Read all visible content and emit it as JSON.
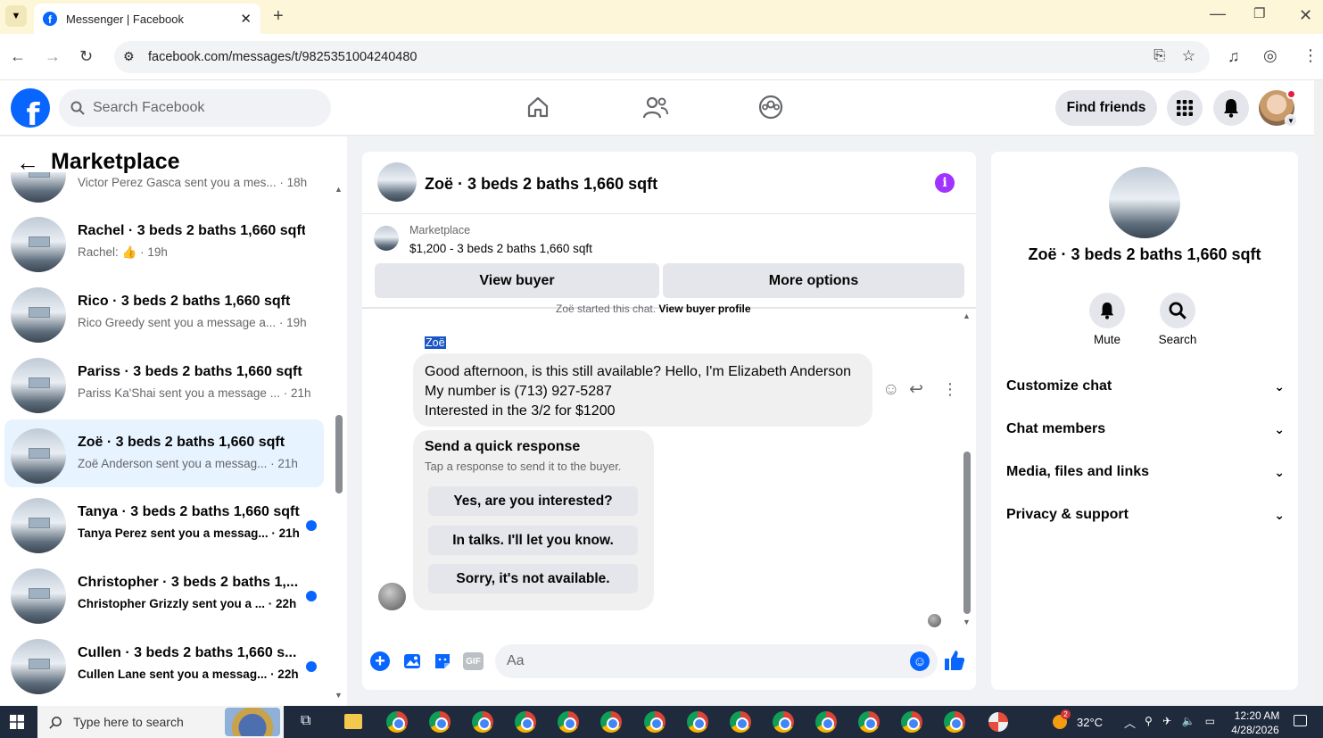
{
  "browser": {
    "tab_title": "Messenger | Facebook",
    "url": "facebook.com/messages/t/9825351004240480"
  },
  "fb_header": {
    "search_placeholder": "Search Facebook",
    "find_friends": "Find friends"
  },
  "marketplace": {
    "title": "Marketplace",
    "conversations": [
      {
        "title": "Victor · 3 beds 2 baths 1,660 sqft",
        "snippet": "Victor Perez Gasca sent you a mes... · 18h",
        "unread": false,
        "active": false
      },
      {
        "title": "Rachel · 3 beds 2 baths 1,660 sqft",
        "snippet": "Rachel: 👍 · 19h",
        "unread": false,
        "active": false
      },
      {
        "title": "Rico · 3 beds 2 baths 1,660 sqft",
        "snippet": "Rico Greedy sent you a message a... · 19h",
        "unread": false,
        "active": false
      },
      {
        "title": "Pariss · 3 beds 2 baths 1,660 sqft",
        "snippet": "Pariss Ka'Shai sent you a message ... · 21h",
        "unread": false,
        "active": false
      },
      {
        "title": "Zoë · 3 beds 2 baths 1,660 sqft",
        "snippet": "Zoë Anderson sent you a messag... · 21h",
        "unread": false,
        "active": true
      },
      {
        "title": "Tanya · 3 beds 2 baths 1,660 sqft",
        "snippet": "Tanya Perez sent you a messag... · 21h",
        "unread": true,
        "active": false
      },
      {
        "title": "Christopher · 3 beds 2 baths 1,...",
        "snippet": "Christopher Grizzly sent you a ... · 22h",
        "unread": true,
        "active": false
      },
      {
        "title": "Cullen · 3 beds 2 baths 1,660 s...",
        "snippet": "Cullen Lane sent you a messag... · 22h",
        "unread": true,
        "active": false
      }
    ]
  },
  "chat": {
    "title": "Zoë · 3 beds 2 baths 1,660 sqft",
    "listing_label": "Marketplace",
    "listing_text": "$1,200 - 3 beds 2 baths 1,660 sqft",
    "view_buyer": "View buyer",
    "more_options": "More options",
    "started_text": "Zoë started this chat.",
    "view_buyer_profile": "View buyer profile",
    "sender_name": "Zoë",
    "message_lines": [
      "Good afternoon, is this still available? Hello, I'm Elizabeth Anderson",
      "My number is (713) 927-5287",
      "Interested in the 3/2 for $1200"
    ],
    "quick_title": "Send a quick response",
    "quick_subtitle": "Tap a response to send it to the buyer.",
    "quick_responses": [
      "Yes, are you interested?",
      "In talks. I'll let you know.",
      "Sorry, it's not available."
    ],
    "composer_placeholder": "Aa",
    "gif_label": "GIF"
  },
  "details": {
    "name": "Zoë · 3 beds 2 baths 1,660 sqft",
    "mute": "Mute",
    "search": "Search",
    "sections": [
      "Customize chat",
      "Chat members",
      "Media, files and links",
      "Privacy & support"
    ]
  },
  "taskbar": {
    "search_placeholder": "Type here to search",
    "temperature": "32°C",
    "time": "12:20 AM",
    "date": "4/28/2026",
    "weather_badge": "2"
  },
  "colors": {
    "fb_blue": "#0866ff",
    "info_purple": "#a033ff",
    "active_row": "#e7f3ff"
  }
}
